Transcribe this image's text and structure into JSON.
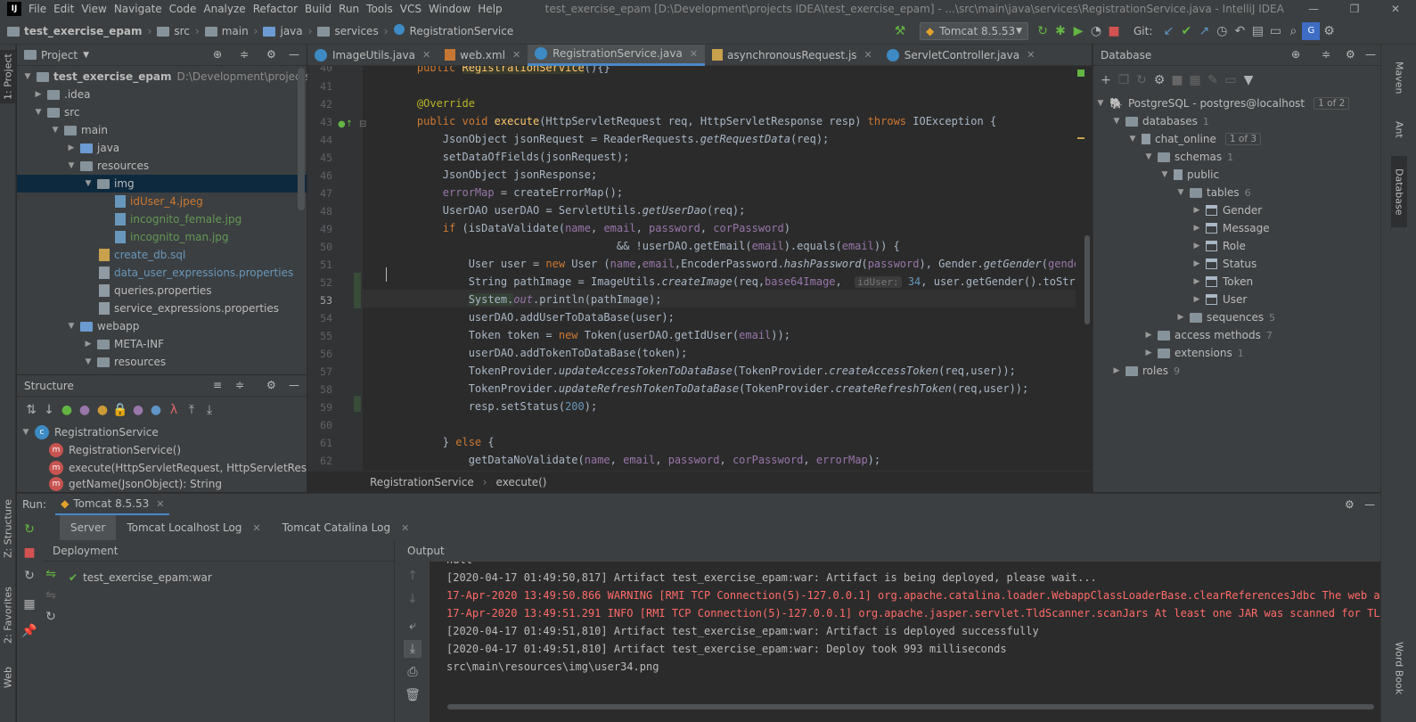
{
  "menubar": {
    "items": [
      "File",
      "Edit",
      "View",
      "Navigate",
      "Code",
      "Analyze",
      "Refactor",
      "Build",
      "Run",
      "Tools",
      "VCS",
      "Window",
      "Help"
    ],
    "title": "test_exercise_epam [D:\\Development\\projects IDEA\\test_exercise_epam] - ...\\src\\main\\java\\services\\RegistrationService.java - IntelliJ IDEA"
  },
  "navbar": {
    "crumbs": [
      "test_exercise_epam",
      "src",
      "main",
      "java",
      "services",
      "RegistrationService"
    ],
    "run_config": "Tomcat 8.5.53",
    "git_label": "Git:"
  },
  "left_stripe": {
    "project_tab": "1: Project",
    "structure_tab": "Z: Structure",
    "favorites_tab": "2: Favorites",
    "web_tab": "Web"
  },
  "right_stripe": {
    "maven_tab": "Maven",
    "ant_tab": "Ant",
    "database_tab": "Database",
    "wordbook_tab": "Word Book"
  },
  "project": {
    "title": "Project",
    "tree": [
      {
        "label": "test_exercise_epam",
        "extra": "D:\\Development\\projects IDEA\\te"
      },
      {
        "label": ".idea"
      },
      {
        "label": "src"
      },
      {
        "label": "main"
      },
      {
        "label": "java"
      },
      {
        "label": "resources"
      },
      {
        "label": "img"
      },
      {
        "label": "idUser_4.jpeg"
      },
      {
        "label": "incognito_female.jpg"
      },
      {
        "label": "incognito_man.jpg"
      },
      {
        "label": "create_db.sql"
      },
      {
        "label": "data_user_expressions.properties"
      },
      {
        "label": "queries.properties"
      },
      {
        "label": "service_expressions.properties"
      },
      {
        "label": "webapp"
      },
      {
        "label": "META-INF"
      },
      {
        "label": "resources"
      }
    ]
  },
  "structure": {
    "title": "Structure",
    "items": [
      "RegistrationService",
      "RegistrationService()",
      "execute(HttpServletRequest, HttpServletResponse",
      "getName(JsonObject): String"
    ]
  },
  "editor": {
    "tabs": [
      "ImageUtils.java",
      "web.xml",
      "RegistrationService.java",
      "asynchronousRequest.js",
      "ServletController.java"
    ],
    "active_tab": "RegistrationService.java",
    "line_numbers": [
      "40",
      "41",
      "42",
      "43",
      "44",
      "45",
      "46",
      "47",
      "48",
      "49",
      "50",
      "51",
      "52",
      "53",
      "54",
      "55",
      "56",
      "57",
      "58",
      "59",
      "60",
      "61",
      "62"
    ],
    "breadcrumb": [
      "RegistrationService",
      "execute()"
    ]
  },
  "database": {
    "title": "Database",
    "connection": "PostgreSQL - postgres@localhost",
    "connection_badge": "1 of 2",
    "databases": "databases",
    "databases_count": "1",
    "db_name": "chat_online",
    "db_badge": "1 of 3",
    "schemas": "schemas",
    "schemas_count": "1",
    "schema_name": "public",
    "tables": "tables",
    "tables_count": "6",
    "table_list": [
      "Gender",
      "Message",
      "Role",
      "Status",
      "Token",
      "User"
    ],
    "sequences": "sequences",
    "sequences_count": "5",
    "access_methods": "access methods",
    "access_methods_count": "7",
    "extensions": "extensions",
    "extensions_count": "1",
    "roles": "roles",
    "roles_count": "9"
  },
  "run": {
    "label": "Run:",
    "config_tab": "Tomcat 8.5.53",
    "tabs": [
      "Server",
      "Tomcat Localhost Log",
      "Tomcat Catalina Log"
    ],
    "deployment_header": "Deployment",
    "output_header": "Output",
    "artifact": "test_exercise_epam:war",
    "output_lines": [
      {
        "text": "null",
        "level": "info"
      },
      {
        "text": "[2020-04-17 01:49:50,817] Artifact test_exercise_epam:war: Artifact is being deployed, please wait...",
        "level": "info"
      },
      {
        "text": "17-Apr-2020 13:49:50.866 WARNING [RMI TCP Connection(5)-127.0.0.1] org.apache.catalina.loader.WebappClassLoaderBase.clearReferencesJdbc The web application",
        "level": "error"
      },
      {
        "text": "17-Apr-2020 13:49:51.291 INFO [RMI TCP Connection(5)-127.0.0.1] org.apache.jasper.servlet.TldScanner.scanJars At least one JAR was scanned for TLDs yet con",
        "level": "error"
      },
      {
        "text": "[2020-04-17 01:49:51,810] Artifact test_exercise_epam:war: Artifact is deployed successfully",
        "level": "info"
      },
      {
        "text": "[2020-04-17 01:49:51,810] Artifact test_exercise_epam:war: Deploy took 993 milliseconds",
        "level": "info"
      },
      {
        "text": "src\\main\\resources\\img\\user34.png",
        "level": "info"
      }
    ]
  },
  "colors": {
    "accent": "#4a88c7",
    "bg": "#2b2b2b",
    "panel": "#3c3f41",
    "error": "#ff6b68",
    "keyword": "#cc7832"
  }
}
